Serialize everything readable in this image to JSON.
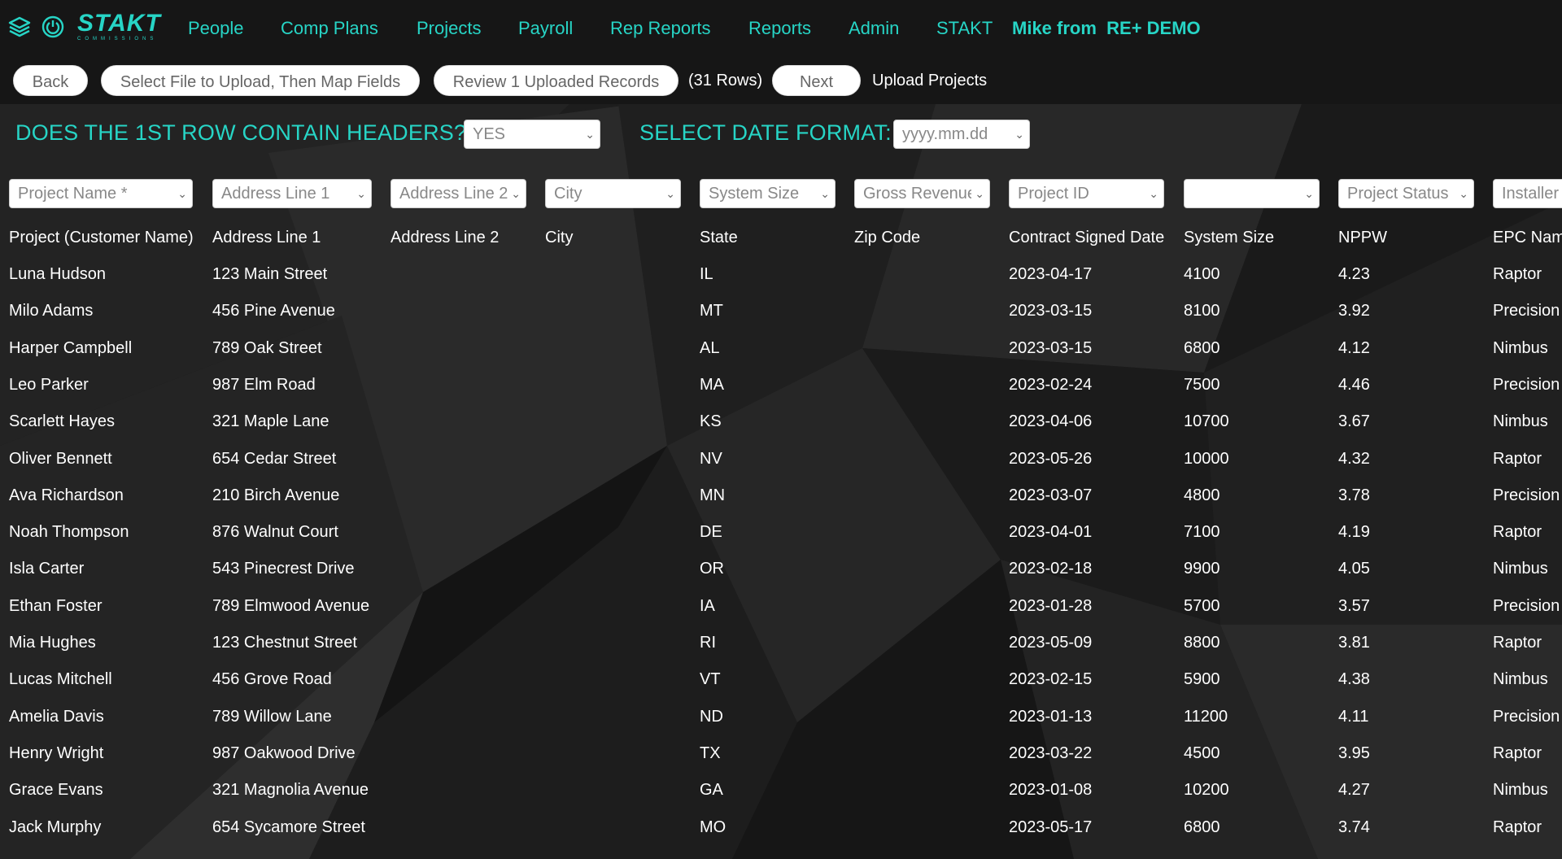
{
  "nav": {
    "brand": "STAKT",
    "brand_sub": "COMMISSIONS",
    "items": [
      "People",
      "Comp Plans",
      "Projects",
      "Payroll",
      "Rep Reports",
      "Reports",
      "Admin",
      "STAKT"
    ],
    "user": "Mike from  RE+ DEMO"
  },
  "toolbar": {
    "back": "Back",
    "select_file": "Select File to Upload, Then Map Fields",
    "review": "Review 1 Uploaded Records",
    "rows": "(31 Rows)",
    "next": "Next",
    "title": "Upload Projects"
  },
  "options": {
    "headers_question": "DOES THE 1ST ROW CONTAIN HEADERS?",
    "headers_value": "YES",
    "date_format_label": "SELECT DATE FORMAT:",
    "date_format_value": "yyyy.mm.dd"
  },
  "mapping_selects": [
    "Project Name *",
    "Address Line 1",
    "Address Line 2",
    "City",
    "System Size",
    "Gross Revenue",
    "Project ID",
    "",
    "Project Status",
    "Installer"
  ],
  "table": {
    "headers": [
      "Project (Customer Name)",
      "Address Line 1",
      "Address Line 2",
      "City",
      "State",
      "Zip Code",
      "Contract Signed Date",
      "System Size",
      "NPPW",
      "EPC Name"
    ],
    "rows": [
      [
        "Luna Hudson",
        "123 Main Street",
        "",
        "",
        "IL",
        "",
        "2023-04-17",
        "4100",
        "4.23",
        "Raptor"
      ],
      [
        "Milo Adams",
        "456 Pine Avenue",
        "",
        "",
        "MT",
        "",
        "2023-03-15",
        "8100",
        "3.92",
        "Precision"
      ],
      [
        "Harper Campbell",
        "789 Oak Street",
        "",
        "",
        "AL",
        "",
        "2023-03-15",
        "6800",
        "4.12",
        "Nimbus"
      ],
      [
        "Leo Parker",
        "987 Elm Road",
        "",
        "",
        "MA",
        "",
        "2023-02-24",
        "7500",
        "4.46",
        "Precision"
      ],
      [
        "Scarlett Hayes",
        "321 Maple Lane",
        "",
        "",
        "KS",
        "",
        "2023-04-06",
        "10700",
        "3.67",
        "Nimbus"
      ],
      [
        "Oliver Bennett",
        "654 Cedar Street",
        "",
        "",
        "NV",
        "",
        "2023-05-26",
        "10000",
        "4.32",
        "Raptor"
      ],
      [
        "Ava Richardson",
        "210 Birch Avenue",
        "",
        "",
        "MN",
        "",
        "2023-03-07",
        "4800",
        "3.78",
        "Precision"
      ],
      [
        "Noah Thompson",
        "876 Walnut Court",
        "",
        "",
        "DE",
        "",
        "2023-04-01",
        "7100",
        "4.19",
        "Raptor"
      ],
      [
        "Isla Carter",
        "543 Pinecrest Drive",
        "",
        "",
        "OR",
        "",
        "2023-02-18",
        "9900",
        "4.05",
        "Nimbus"
      ],
      [
        "Ethan Foster",
        "789 Elmwood Avenue",
        "",
        "",
        "IA",
        "",
        "2023-01-28",
        "5700",
        "3.57",
        "Precision"
      ],
      [
        "Mia Hughes",
        "123 Chestnut Street",
        "",
        "",
        "RI",
        "",
        "2023-05-09",
        "8800",
        "3.81",
        "Raptor"
      ],
      [
        "Lucas Mitchell",
        "456 Grove Road",
        "",
        "",
        "VT",
        "",
        "2023-02-15",
        "5900",
        "4.38",
        "Nimbus"
      ],
      [
        "Amelia Davis",
        "789 Willow Lane",
        "",
        "",
        "ND",
        "",
        "2023-01-13",
        "11200",
        "4.11",
        "Precision"
      ],
      [
        "Henry Wright",
        "987 Oakwood Drive",
        "",
        "",
        "TX",
        "",
        "2023-03-22",
        "4500",
        "3.95",
        "Raptor"
      ],
      [
        "Grace Evans",
        "321 Magnolia Avenue",
        "",
        "",
        "GA",
        "",
        "2023-01-08",
        "10200",
        "4.27",
        "Nimbus"
      ],
      [
        "Jack Murphy",
        "654 Sycamore Street",
        "",
        "",
        "MO",
        "",
        "2023-05-17",
        "6800",
        "3.74",
        "Raptor"
      ]
    ]
  },
  "colors": {
    "accent": "#27d5c6",
    "background": "#1a1a1a",
    "nav_background": "#161616"
  }
}
